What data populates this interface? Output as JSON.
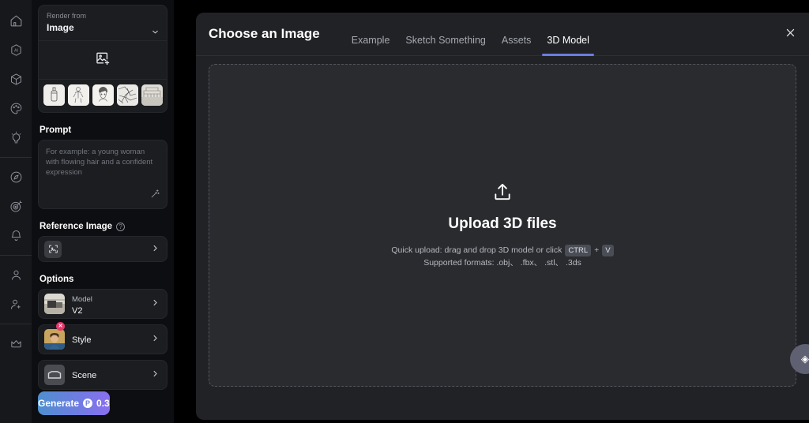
{
  "theme": {
    "background": "#000000",
    "rail_bg": "#17181c",
    "panel_bg": "#0d0e11",
    "card_bg": "#1c1d21",
    "modal_bg": "#212226",
    "dropzone_bg": "#2a2b2f",
    "accent": "#6c7ce0",
    "badge_red": "#e8366b",
    "generate_gradient_from": "#4f8fd0",
    "generate_gradient_to": "#8a6ff0"
  },
  "rail": {
    "items": [
      {
        "icon": "home-icon",
        "label": "Home"
      },
      {
        "icon": "ai-icon",
        "label": "AI"
      },
      {
        "icon": "cube-3d-icon",
        "label": "3D"
      },
      {
        "icon": "palette-icon",
        "label": "Palette"
      },
      {
        "icon": "lightbulb-icon",
        "label": "Ideas"
      },
      {
        "icon": "compass-icon",
        "label": "Explore"
      },
      {
        "icon": "target-icon",
        "label": "Target"
      },
      {
        "icon": "bell-icon",
        "label": "Notifications"
      },
      {
        "icon": "user-icon",
        "label": "Profile"
      },
      {
        "icon": "user-add-icon",
        "label": "Invite"
      },
      {
        "icon": "crown-icon",
        "label": "Upgrade"
      }
    ]
  },
  "panel": {
    "render_from": {
      "label": "Render from",
      "value": "Image",
      "chevron": "chevron-down-icon"
    },
    "image_dropzone_icon": "add-image-icon",
    "thumbnails": [
      {
        "name": "sketch-bottle"
      },
      {
        "name": "sketch-anatomy"
      },
      {
        "name": "sketch-portrait"
      },
      {
        "name": "sketch-lineart"
      },
      {
        "name": "sketch-interior"
      }
    ],
    "prompt": {
      "title": "Prompt",
      "placeholder": "For example: a young woman with flowing hair and a confident expression",
      "value": "",
      "wand_icon": "magic-wand-icon"
    },
    "reference_image": {
      "title": "Reference Image",
      "help_icon": "help-circle-icon",
      "help_glyph": "?",
      "thumb_icon": "image-frame-icon",
      "chevron": "chevron-right-icon"
    },
    "options": {
      "title": "Options",
      "rows": [
        {
          "label": "Model",
          "value": "V2",
          "thumb": "model-thumb",
          "badge": null
        },
        {
          "label": "Style",
          "value": "",
          "thumb": "style-thumb",
          "badge": "✕"
        },
        {
          "label": "Scene",
          "value": "",
          "thumb": "scene-thumb",
          "badge": null
        }
      ]
    },
    "generate": {
      "label": "Generate",
      "credit_glyph": "P",
      "cost": "0.3"
    }
  },
  "modal": {
    "title": "Choose an Image",
    "close_icon": "close-icon",
    "tabs": [
      {
        "label": "Example",
        "active": false
      },
      {
        "label": "Sketch Something",
        "active": false
      },
      {
        "label": "Assets",
        "active": false
      },
      {
        "label": "3D Model",
        "active": true
      }
    ],
    "dropzone": {
      "upload_icon": "upload-icon",
      "title": "Upload 3D files",
      "hint_prefix": "Quick upload: drag and drop 3D model or click",
      "hint_key": "CTRL",
      "hint_plus": "+",
      "hint_key2": "V",
      "formats": "Supported formats: .obj、 .fbx、 .stl、 .3ds"
    }
  },
  "fab": {
    "icon": "assistant-icon",
    "glyph": "◈"
  }
}
